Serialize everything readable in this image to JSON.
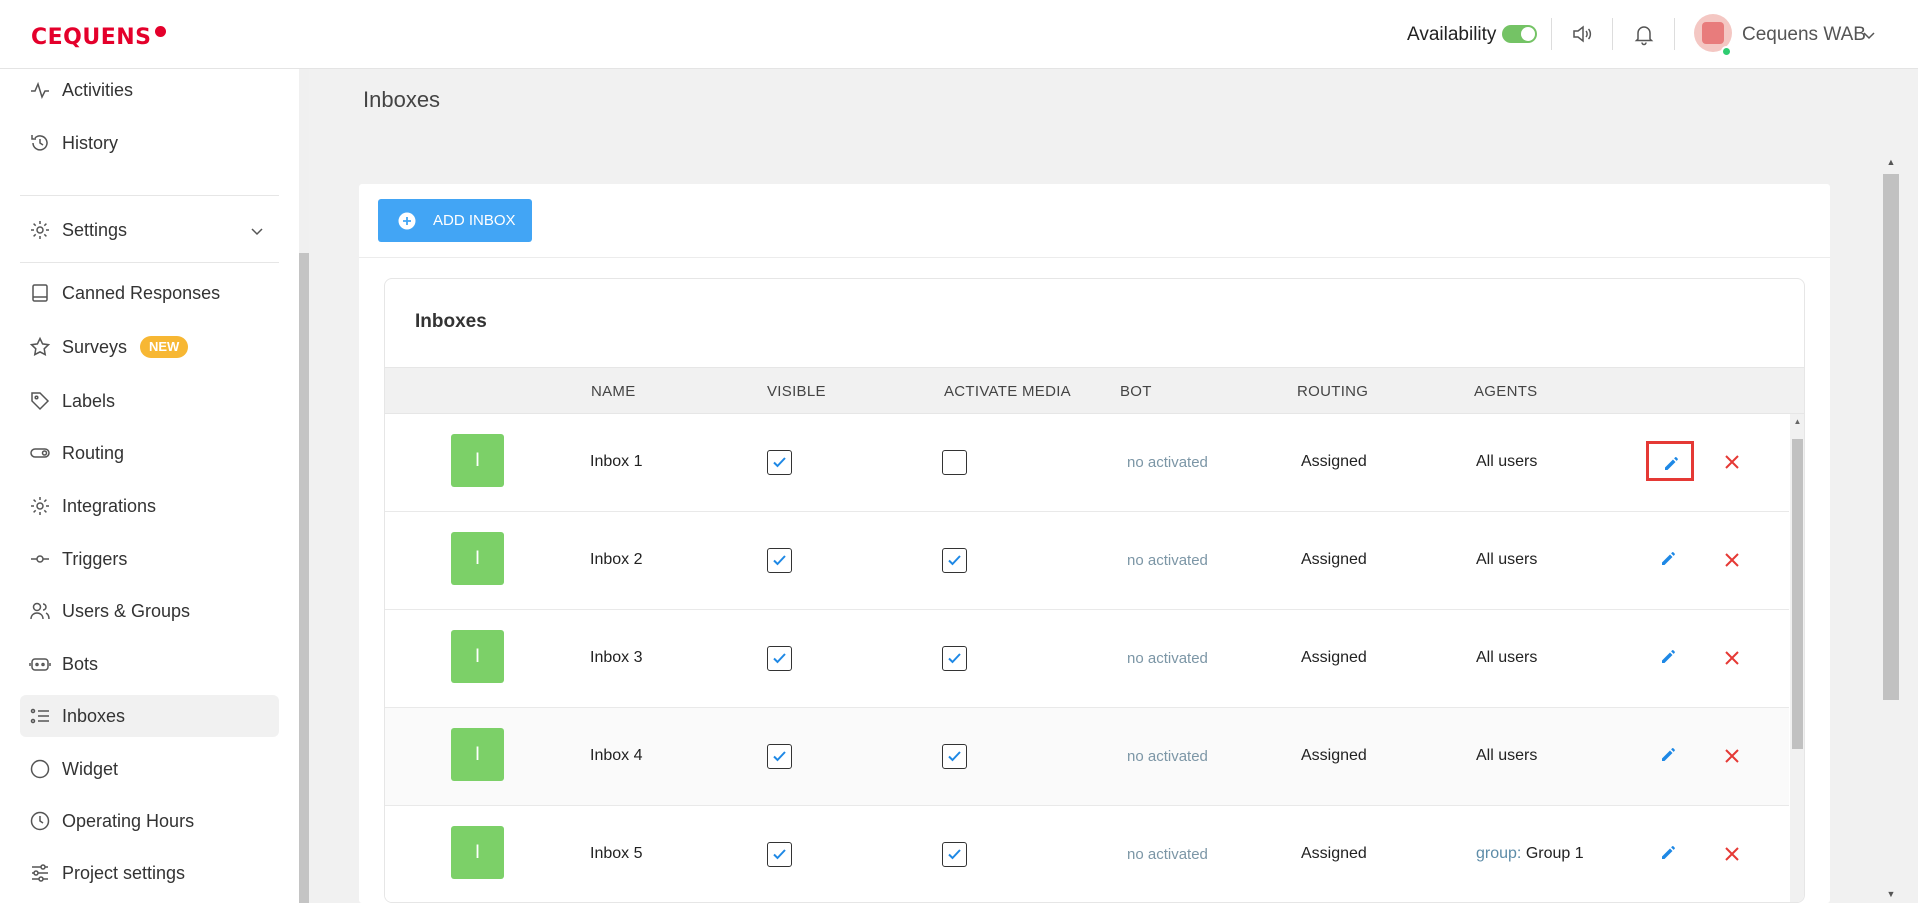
{
  "header": {
    "logo": "CEQUENS",
    "availability_label": "Availability",
    "user_name": "Cequens WAB"
  },
  "sidebar": {
    "items": [
      {
        "label": "Activities",
        "icon": "activity-icon"
      },
      {
        "label": "History",
        "icon": "history-icon"
      },
      {
        "label": "Settings",
        "icon": "gear-icon"
      },
      {
        "label": "Canned Responses",
        "icon": "book-icon"
      },
      {
        "label": "Surveys",
        "icon": "star-icon",
        "badge": "NEW"
      },
      {
        "label": "Labels",
        "icon": "tag-icon"
      },
      {
        "label": "Routing",
        "icon": "routing-icon"
      },
      {
        "label": "Integrations",
        "icon": "gear-icon"
      },
      {
        "label": "Triggers",
        "icon": "trigger-icon"
      },
      {
        "label": "Users & Groups",
        "icon": "users-icon"
      },
      {
        "label": "Bots",
        "icon": "bot-icon"
      },
      {
        "label": "Inboxes",
        "icon": "list-icon",
        "active": true
      },
      {
        "label": "Widget",
        "icon": "circle-icon"
      },
      {
        "label": "Operating Hours",
        "icon": "clock-icon"
      },
      {
        "label": "Project settings",
        "icon": "sliders-icon"
      }
    ]
  },
  "main": {
    "page_title": "Inboxes",
    "add_button_label": "ADD INBOX",
    "table_title": "Inboxes",
    "columns": [
      "NAME",
      "VISIBLE",
      "ACTIVATE MEDIA",
      "BOT",
      "ROUTING",
      "AGENTS"
    ],
    "rows": [
      {
        "icon_letter": "I",
        "name": "Inbox 1",
        "visible": true,
        "activate_media": false,
        "bot": "no activated",
        "routing": "Assigned",
        "agents": "All users",
        "agents_prefix": ""
      },
      {
        "icon_letter": "I",
        "name": "Inbox 2",
        "visible": true,
        "activate_media": true,
        "bot": "no activated",
        "routing": "Assigned",
        "agents": "All users",
        "agents_prefix": ""
      },
      {
        "icon_letter": "I",
        "name": "Inbox 3",
        "visible": true,
        "activate_media": true,
        "bot": "no activated",
        "routing": "Assigned",
        "agents": "All users",
        "agents_prefix": ""
      },
      {
        "icon_letter": "I",
        "name": "Inbox 4",
        "visible": true,
        "activate_media": true,
        "bot": "no activated",
        "routing": "Assigned",
        "agents": "All users",
        "agents_prefix": ""
      },
      {
        "icon_letter": "I",
        "name": "Inbox 5",
        "visible": true,
        "activate_media": true,
        "bot": "no activated",
        "routing": "Assigned",
        "agents": "Group 1",
        "agents_prefix": "group:"
      }
    ]
  },
  "colors": {
    "brand": "#e4002b",
    "accent": "#42a5f5",
    "inbox_icon": "#7cd068",
    "delete": "#e53935",
    "badge": "#f7b733"
  }
}
